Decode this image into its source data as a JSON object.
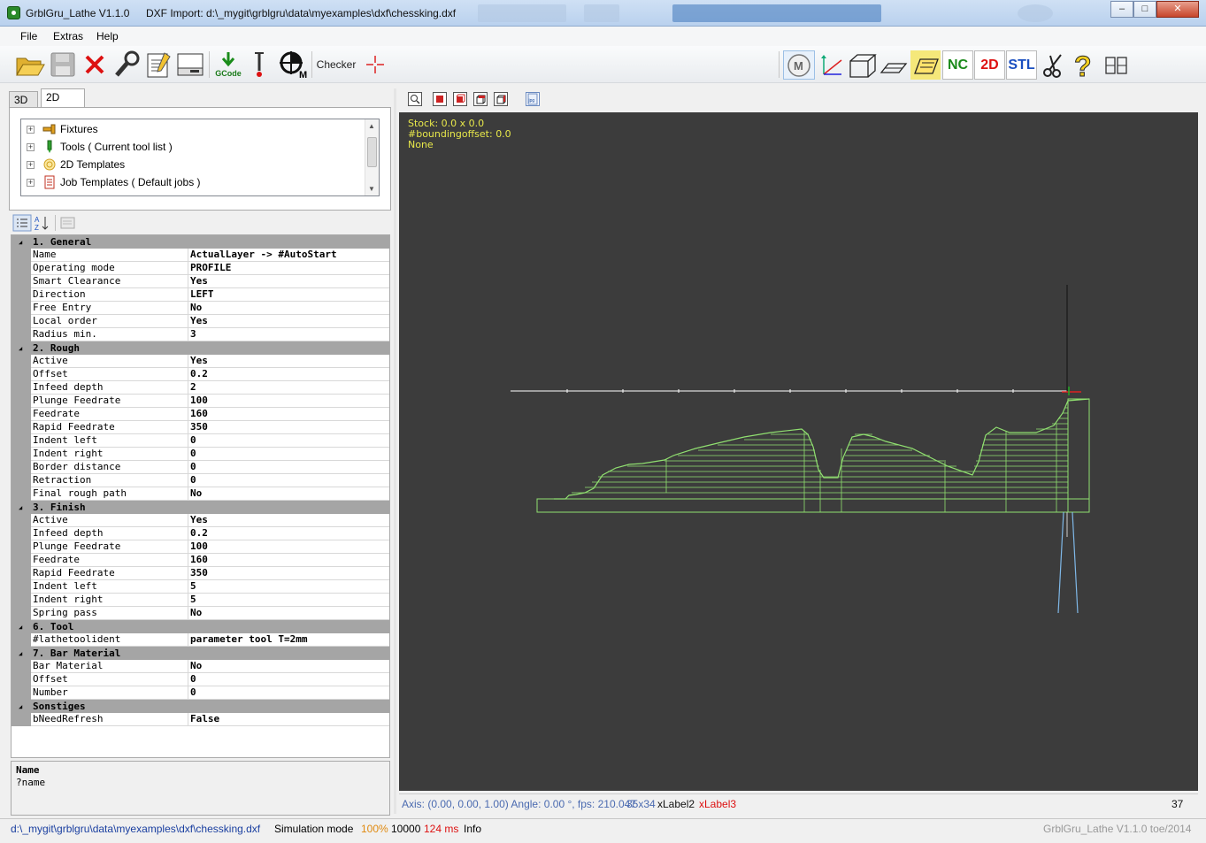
{
  "window": {
    "app_title": "GrblGru_Lathe V1.1.0",
    "doc_title": "DXF Import: d:\\_mygit\\grblgru\\data\\myexamples\\dxf\\chessking.dxf",
    "minimize": "–",
    "maximize": "□",
    "close": "✕"
  },
  "menu": {
    "file": "File",
    "extras": "Extras",
    "help": "Help"
  },
  "toolbar": {
    "gcode_label": "GCode",
    "checker_label": "Checker",
    "right": {
      "m_label": "M",
      "nc_label": "NC",
      "twod_label": "2D",
      "stl_label": "STL"
    }
  },
  "tabs": {
    "tab3d": "3D",
    "tab2d": "2D"
  },
  "tree": {
    "items": [
      {
        "label": "Fixtures",
        "icon": "fixture-icon"
      },
      {
        "label": "Tools  ( Current tool list )",
        "icon": "tool-icon"
      },
      {
        "label": "2D Templates",
        "icon": "template-icon"
      },
      {
        "label": "Job Templates  ( Default jobs )",
        "icon": "job-icon"
      }
    ]
  },
  "properties": {
    "categories": [
      {
        "title": "1. General",
        "rows": [
          {
            "name": "Name",
            "value": "ActualLayer  -> #AutoStart"
          },
          {
            "name": "Operating mode",
            "value": "PROFILE"
          },
          {
            "name": "Smart Clearance",
            "value": "Yes"
          },
          {
            "name": "Direction",
            "value": "LEFT"
          },
          {
            "name": "Free Entry",
            "value": "No"
          },
          {
            "name": "Local order",
            "value": "Yes"
          },
          {
            "name": "Radius min.",
            "value": "3"
          }
        ]
      },
      {
        "title": "2. Rough",
        "rows": [
          {
            "name": "Active",
            "value": "Yes"
          },
          {
            "name": "Offset",
            "value": "0.2"
          },
          {
            "name": "Infeed depth",
            "value": "2"
          },
          {
            "name": "Plunge Feedrate",
            "value": "100"
          },
          {
            "name": "Feedrate",
            "value": "160"
          },
          {
            "name": "Rapid Feedrate",
            "value": "350"
          },
          {
            "name": "Indent left",
            "value": "0"
          },
          {
            "name": "Indent right",
            "value": "0"
          },
          {
            "name": "Border distance",
            "value": "0"
          },
          {
            "name": "Retraction",
            "value": "0"
          },
          {
            "name": "Final rough path",
            "value": "No"
          }
        ]
      },
      {
        "title": "3. Finish",
        "rows": [
          {
            "name": "Active",
            "value": "Yes"
          },
          {
            "name": "Infeed depth",
            "value": "0.2"
          },
          {
            "name": "Plunge Feedrate",
            "value": "100"
          },
          {
            "name": "Feedrate",
            "value": "160"
          },
          {
            "name": "Rapid Feedrate",
            "value": "350"
          },
          {
            "name": "Indent left",
            "value": "5"
          },
          {
            "name": "Indent right",
            "value": "5"
          },
          {
            "name": "Spring pass",
            "value": "No"
          }
        ]
      },
      {
        "title": "6. Tool",
        "rows": [
          {
            "name": "#lathetoolident",
            "value": "parameter tool T=2mm"
          }
        ]
      },
      {
        "title": "7. Bar Material",
        "rows": [
          {
            "name": "Bar Material",
            "value": "No"
          },
          {
            "name": "Offset",
            "value": "0"
          },
          {
            "name": "Number",
            "value": "0"
          }
        ]
      },
      {
        "title": "Sonstiges",
        "rows": [
          {
            "name": "bNeedRefresh",
            "value": "False"
          }
        ]
      }
    ]
  },
  "description": {
    "title": "Name",
    "text": "?name"
  },
  "viewport": {
    "stock": "Stock:  0.0 x 0.0",
    "bounding": "#boundingoffset:  0.0",
    "none": "None",
    "background": "#3c3c3c",
    "path_color": "#90e070",
    "text_color": "#e8e84a"
  },
  "view_status": {
    "axis": "Axis: (0.00, 0.00, 1.00) Angle: 0.00 °, fps: 210.047",
    "size": "35x34",
    "xlabel2": "xLabel2",
    "xlabel3": "xLabel3",
    "count": "37"
  },
  "statusbar": {
    "path": "d:\\_mygit\\grblgru\\data\\myexamples\\dxf\\chessking.dxf",
    "mode": "Simulation mode",
    "percent": "100%",
    "steps": "10000",
    "ms": "124 ms",
    "info": "Info",
    "version": "GrblGru_Lathe V1.1.0 toe/2014"
  }
}
